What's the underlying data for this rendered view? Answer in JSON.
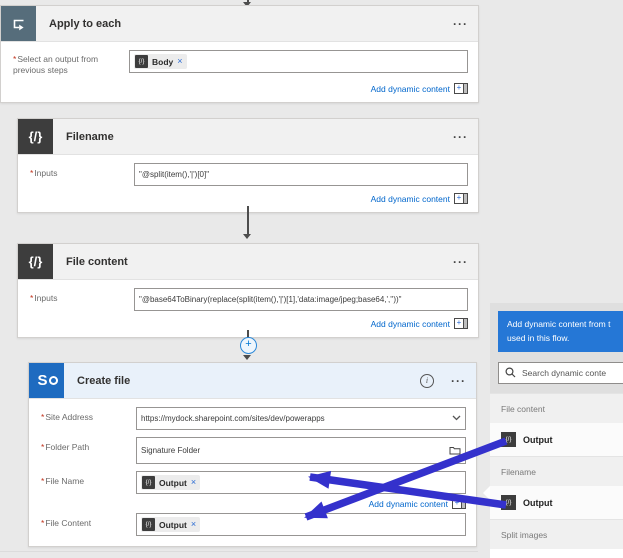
{
  "icons": {
    "ellipsis": "···",
    "expression_glyph": "{/}",
    "close_glyph": "×",
    "info_glyph": "i",
    "sharepoint_letter": "S",
    "required_marker": "*",
    "plus_glyph": "+"
  },
  "apply_to_each": {
    "title": "Apply to each",
    "select_label": "Select an output from previous steps",
    "token": "Body",
    "add_dynamic": "Add dynamic content"
  },
  "filename": {
    "title": "Filename",
    "label": "Inputs",
    "value": "\"@split(item(),'|')[0]\"",
    "add_dynamic": "Add dynamic content"
  },
  "file_content": {
    "title": "File content",
    "label": "Inputs",
    "value": "\"@base64ToBinary(replace(split(item(),'|')[1],'data:image/jpeg;base64,',''))\"",
    "add_dynamic": "Add dynamic content"
  },
  "create_file": {
    "title": "Create file",
    "site_label": "Site Address",
    "site_value": "https://mydock.sharepoint.com/sites/dev/powerapps",
    "folder_label": "Folder Path",
    "folder_value": "Signature Folder",
    "name_label": "File Name",
    "name_token": "Output",
    "content_label": "File Content",
    "content_token": "Output",
    "add_dynamic": "Add dynamic content"
  },
  "panel": {
    "header_line1": "Add dynamic content from t",
    "header_line2": "used in this flow.",
    "search_placeholder": "Search dynamic conte",
    "groups": [
      {
        "label": "File content",
        "item": "Output"
      },
      {
        "label": "Filename",
        "item": "Output"
      },
      {
        "label": "Split images",
        "item": ""
      }
    ]
  },
  "colors": {
    "accent_blue": "#0066cc",
    "panel_header_blue": "#2577d6",
    "annotation_arrow_blue": "#3431cc",
    "sharepoint_blue": "#1e6bc0",
    "expression_icon_dark": "#3d3d3d",
    "apply_icon_slate": "#566d7b"
  }
}
